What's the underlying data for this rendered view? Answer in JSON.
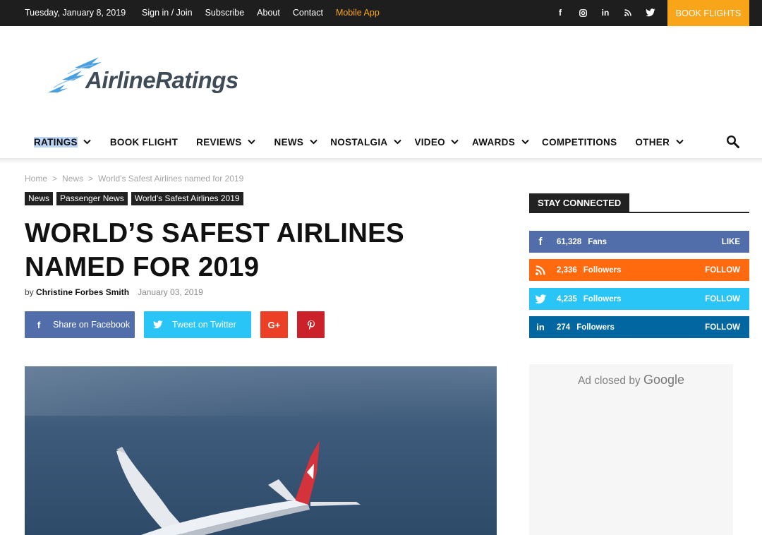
{
  "topbar": {
    "date": "Tuesday, January 8, 2019",
    "links": [
      {
        "label": "Sign in / Join"
      },
      {
        "label": "Subscribe"
      },
      {
        "label": "About"
      },
      {
        "label": "Contact"
      },
      {
        "label": "Mobile App"
      }
    ],
    "social_icons": [
      "facebook-icon",
      "instagram-icon",
      "linkedin-icon",
      "rss-icon",
      "twitter-icon"
    ],
    "book_label": "BOOK FLIGHTS",
    "accent_color": "#f9a51a"
  },
  "logo": {
    "text": "AirlineRatings"
  },
  "nav": {
    "items": [
      {
        "label": "RATINGS"
      },
      {
        "label": "BOOK FLIGHT"
      },
      {
        "label": "REVIEWS"
      },
      {
        "label": "NEWS"
      },
      {
        "label": "NOSTALGIA"
      },
      {
        "label": "VIDEO"
      },
      {
        "label": "AWARDS"
      },
      {
        "label": "COMPETITIONS"
      },
      {
        "label": "OTHER"
      }
    ],
    "search_icon": "search-icon"
  },
  "breadcrumb": {
    "items": [
      "Home",
      "News",
      "World's Safest Airlines named for 2019"
    ],
    "separator": ">"
  },
  "tags": [
    "News",
    "Passenger News",
    "World's Safest Airlines 2019"
  ],
  "article": {
    "title": "WORLD’S SAFEST AIRLINES NAMED FOR 2019",
    "by": "by",
    "author": "Christine Forbes Smith",
    "date": "January 03, 2019"
  },
  "share": {
    "facebook_label": "Share on Facebook",
    "twitter_label": "Tweet on Twitter",
    "googleplus_label": "G+",
    "facebook_color": "#516eab",
    "twitter_color": "#29c5f6",
    "googleplus_color": "#eb4026",
    "pinterest_color": "#ca212a"
  },
  "sidebar": {
    "stay_connected": "STAY CONNECTED",
    "rows": [
      {
        "count": "61,328",
        "what": "Fans",
        "action": "LIKE",
        "icon": "facebook-icon",
        "color": "#516eab"
      },
      {
        "count": "2,336",
        "what": "Followers",
        "action": "FOLLOW",
        "icon": "rss-icon",
        "color": "#ff6a0f"
      },
      {
        "count": "4,235",
        "what": "Followers",
        "action": "FOLLOW",
        "icon": "twitter-icon",
        "color": "#29c5f6"
      },
      {
        "count": "274",
        "what": "Followers",
        "action": "FOLLOW",
        "icon": "linkedin-icon",
        "color": "#0266a0"
      }
    ],
    "ad": {
      "closed_by": "Ad closed by",
      "brand": "Google"
    }
  }
}
